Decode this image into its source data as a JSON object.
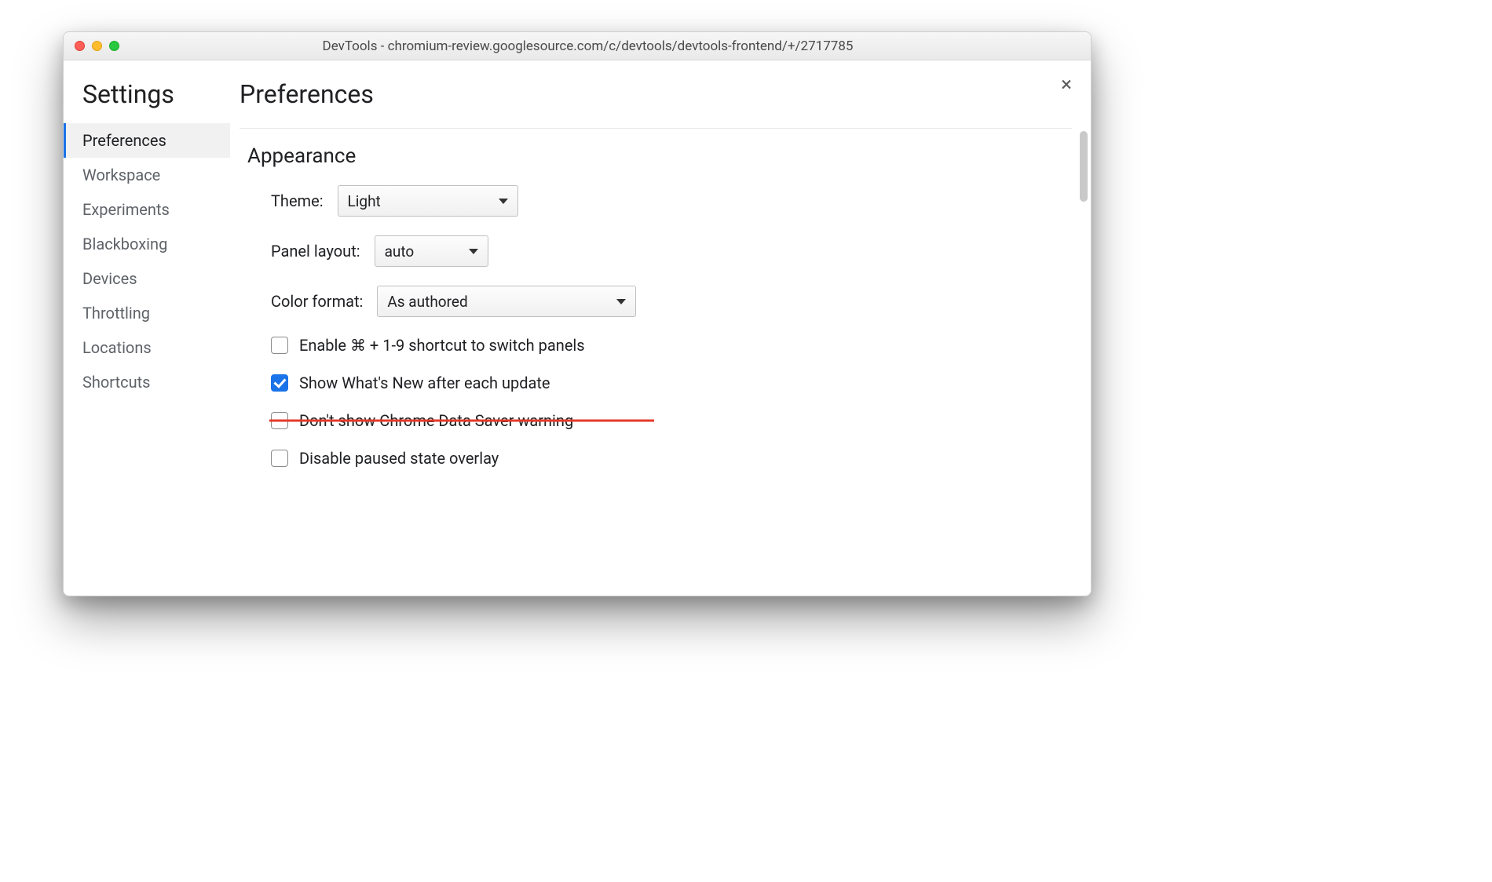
{
  "window": {
    "title": "DevTools - chromium-review.googlesource.com/c/devtools/devtools-frontend/+/2717785"
  },
  "sidebar": {
    "heading": "Settings",
    "items": [
      {
        "label": "Preferences",
        "active": true
      },
      {
        "label": "Workspace"
      },
      {
        "label": "Experiments"
      },
      {
        "label": "Blackboxing"
      },
      {
        "label": "Devices"
      },
      {
        "label": "Throttling"
      },
      {
        "label": "Locations"
      },
      {
        "label": "Shortcuts"
      }
    ]
  },
  "main": {
    "title": "Preferences",
    "section_appearance": "Appearance",
    "fields": {
      "theme_label": "Theme:",
      "theme_value": "Light",
      "panel_label": "Panel layout:",
      "panel_value": "auto",
      "color_label": "Color format:",
      "color_value": "As authored"
    },
    "checks": {
      "shortcut": "Enable ⌘ + 1-9 shortcut to switch panels",
      "whatsnew": "Show What's New after each update",
      "datasaver": "Don't show Chrome Data Saver warning",
      "pausedoverlay": "Disable paused state overlay"
    }
  }
}
